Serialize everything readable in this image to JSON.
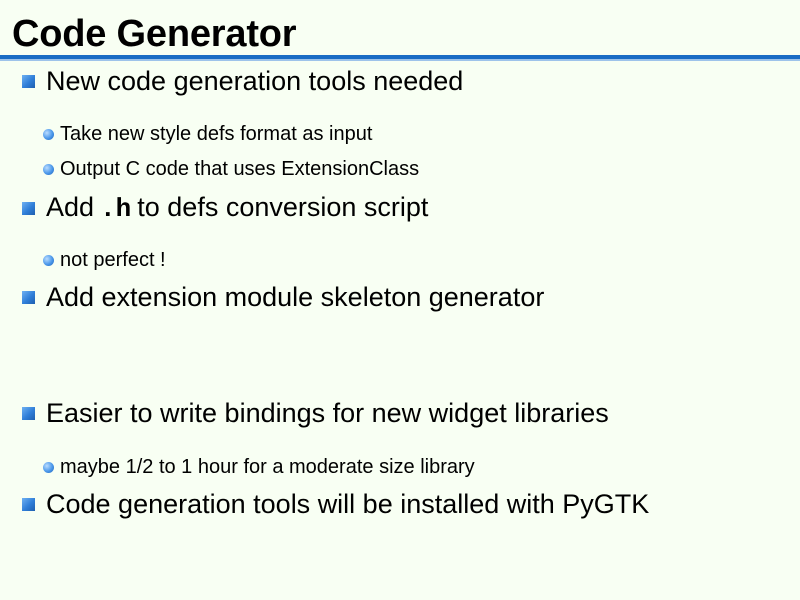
{
  "slide": {
    "title": "Code Generator",
    "bullets": [
      {
        "text": "New code generation tools needed",
        "subs": [
          "Take new style defs format as input",
          "Output C code that uses ExtensionClass"
        ]
      },
      {
        "prefix": "Add",
        "code": ".h",
        "suffix": "to defs conversion script",
        "subs": [
          "not perfect !"
        ]
      },
      {
        "text": "Add extension module skeleton generator",
        "subs": []
      },
      {
        "text": "Easier to write bindings for new widget libraries",
        "subs": [
          "maybe 1/2 to 1 hour for a moderate size library"
        ]
      },
      {
        "text": "Code generation tools will be installed with PyGTK",
        "subs": []
      }
    ]
  },
  "colors": {
    "background": "#f8fff3",
    "rule": "#1a6cc4",
    "bullet": "#2f7ed8"
  }
}
